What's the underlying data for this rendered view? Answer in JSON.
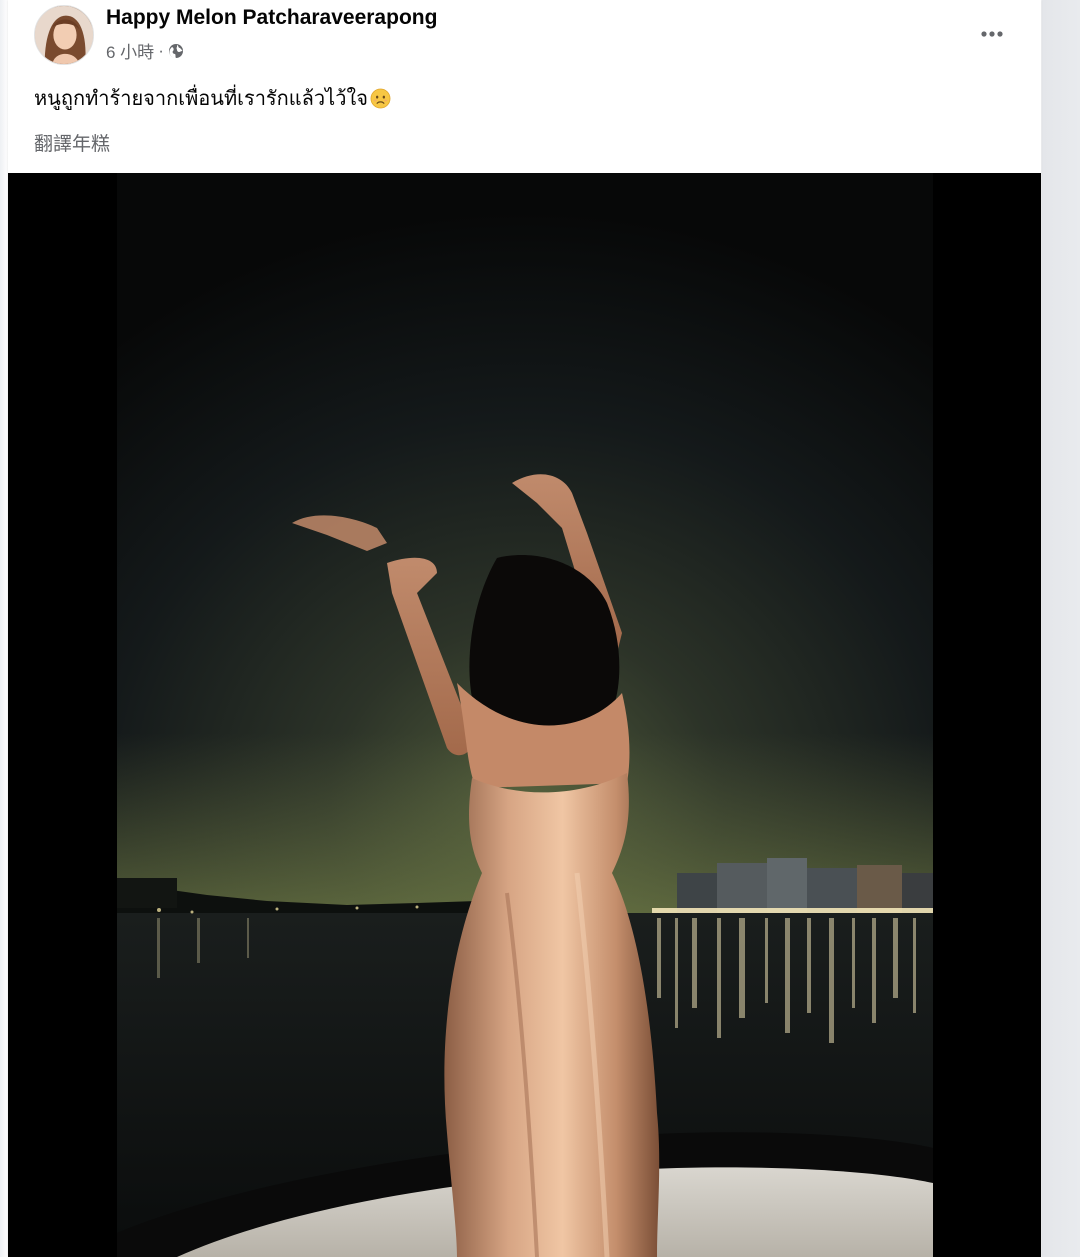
{
  "post": {
    "author": {
      "name": "Happy Melon Patcharaveerapong",
      "avatar_icon": "profile-avatar"
    },
    "timestamp": "6 小時",
    "separator": "·",
    "audience_icon": "globe-icon",
    "more_icon": "more-options-icon",
    "caption": {
      "text": "หนูถูกทำร้ายจากเพื่อนที่เรารักแล้วไว้ใจ",
      "emoji": "sad-face-emoji"
    },
    "translate_label": "翻譯年糕",
    "photo": {
      "description_icon": "night-river-photo"
    }
  }
}
